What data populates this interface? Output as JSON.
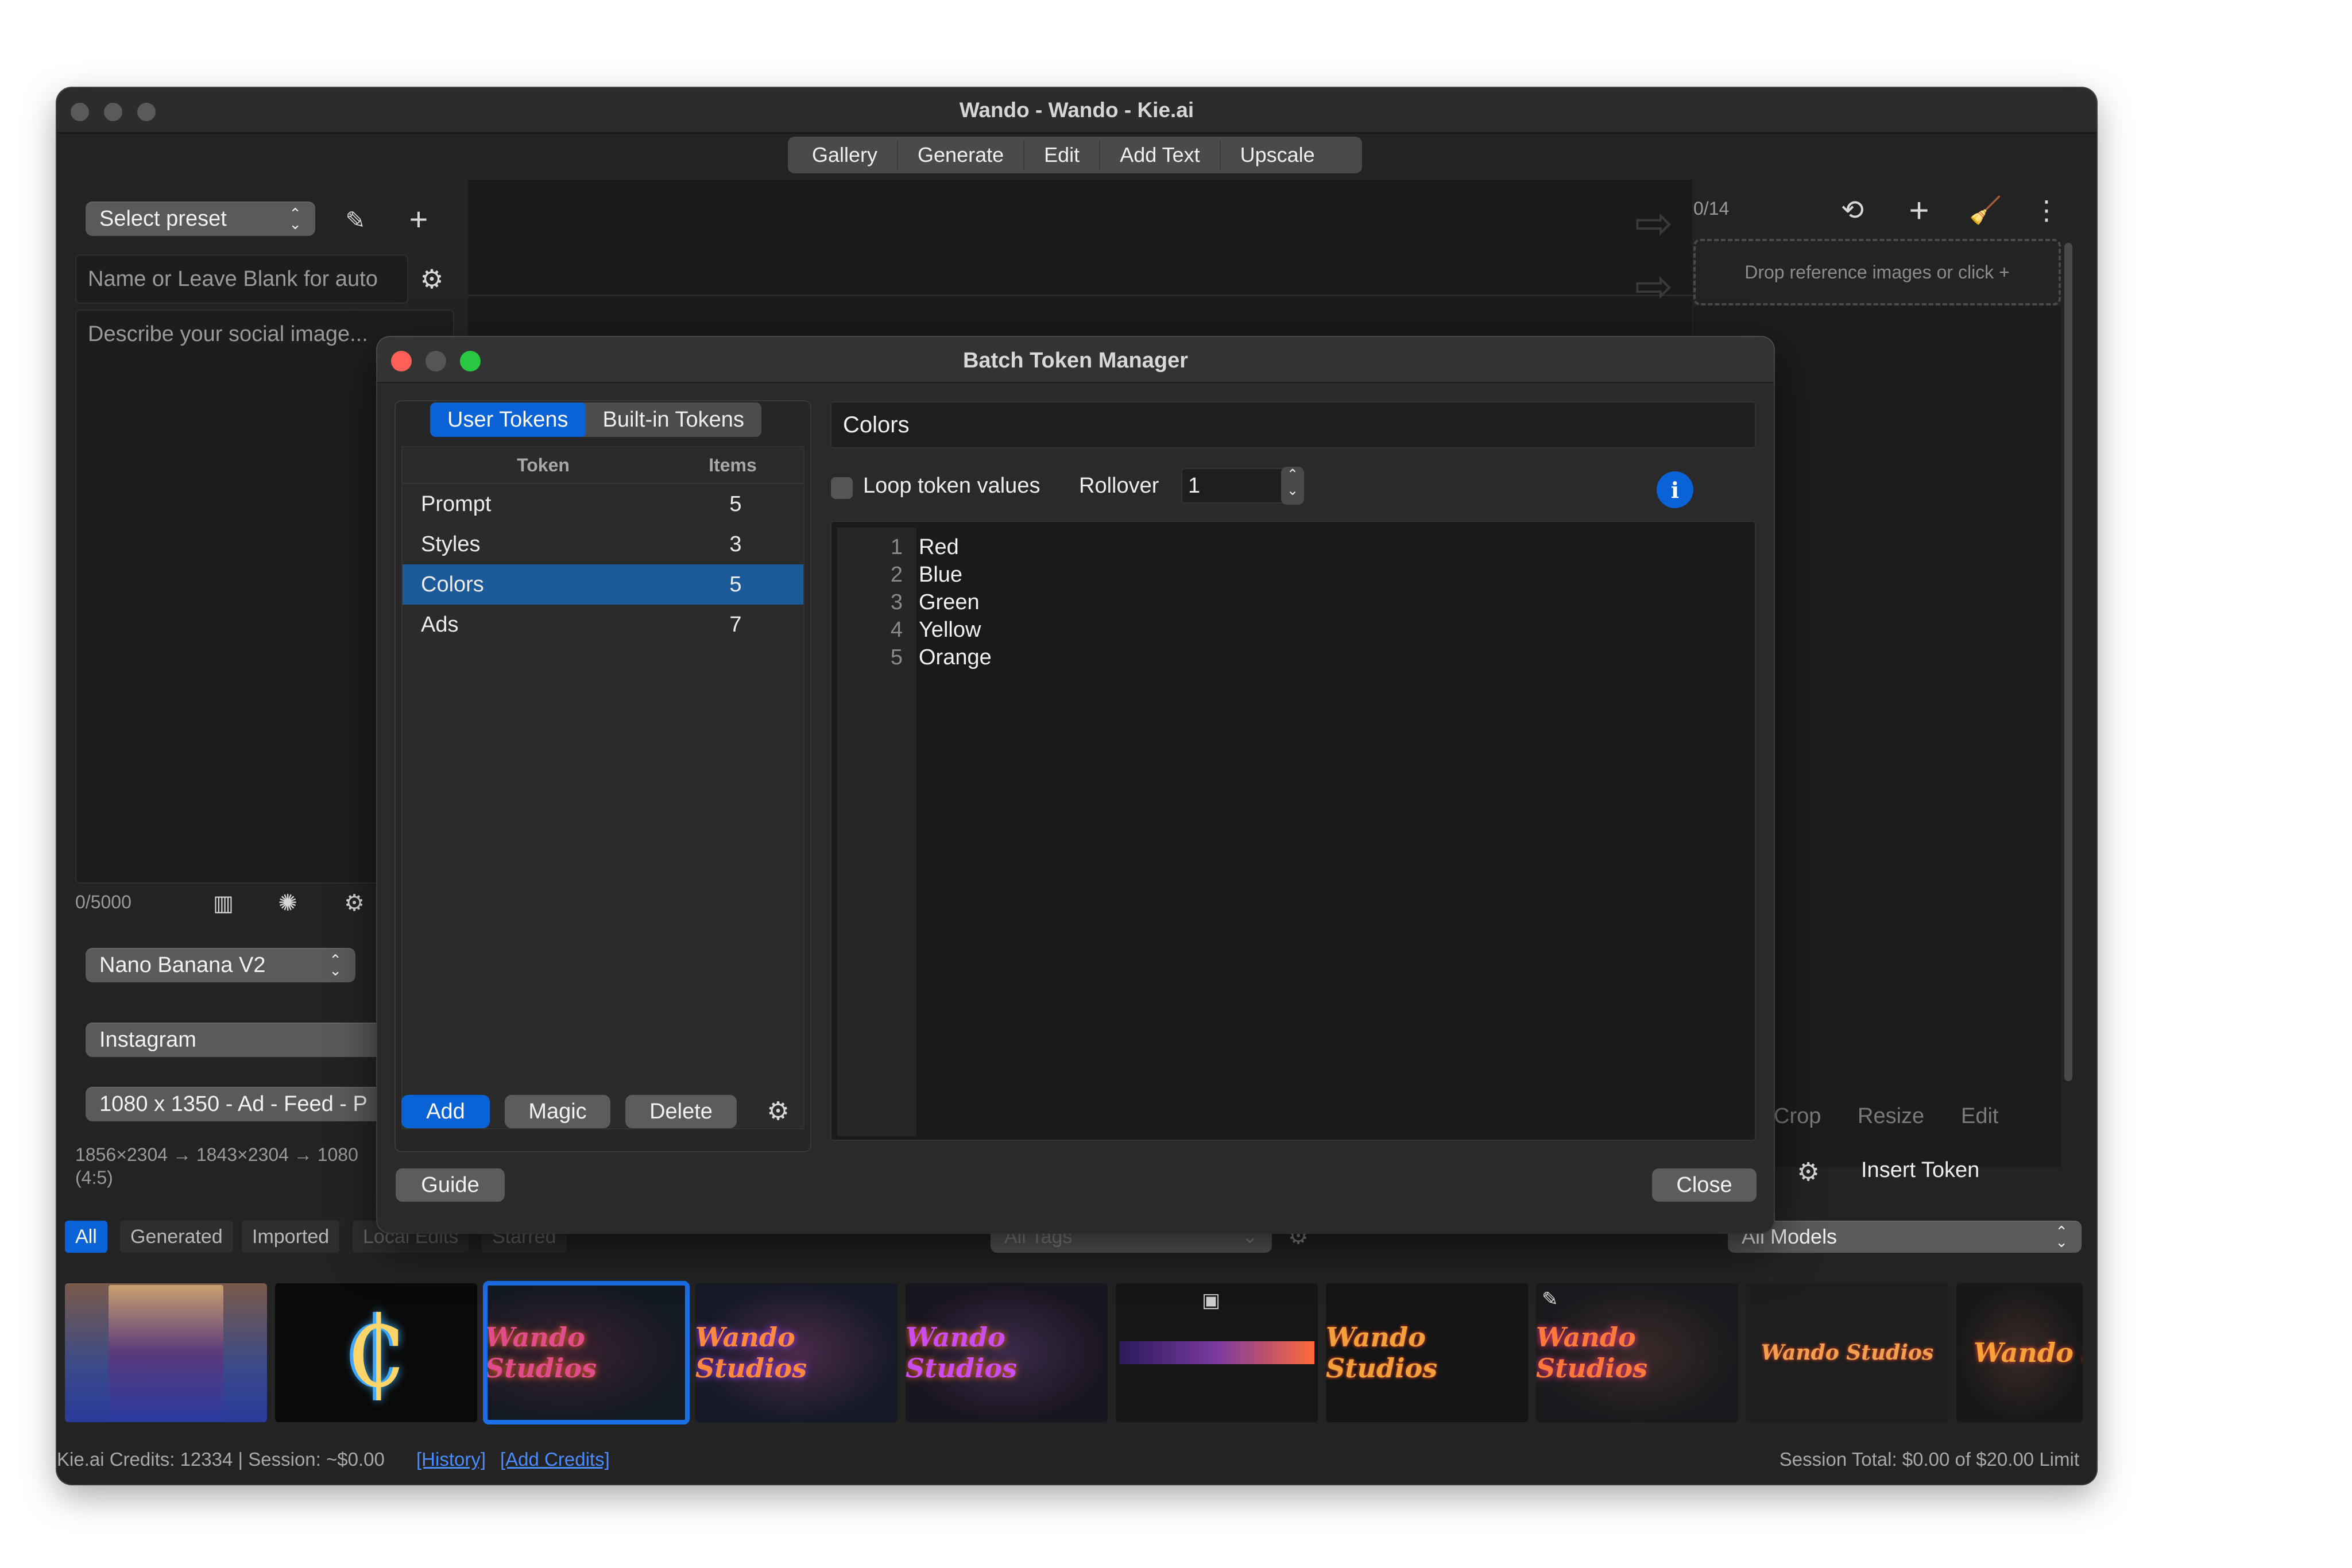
{
  "window": {
    "title": "Wando - Wando - Kie.ai",
    "menu": [
      "Gallery",
      "Generate",
      "Edit",
      "Add Text",
      "Upscale"
    ]
  },
  "left_panel": {
    "preset_select": "Select preset",
    "name_placeholder": "Name or Leave Blank for auto",
    "prompt_placeholder": "Describe your social image...",
    "char_count": "0/5000",
    "model_select": "Nano Banana V2",
    "platform_select": "Instagram",
    "size_select": "1080 x 1350 - Ad - Feed - P",
    "dimensions_line1": "1856×2304 → 1843×2304 → 1080",
    "dimensions_line2": "(4:5)"
  },
  "right_panel": {
    "ref_count": "0/14",
    "drop_hint": "Drop reference images or click +",
    "tools": [
      "Crop",
      "Resize",
      "Edit"
    ],
    "insert_token": "Insert Token"
  },
  "gallery_filters": {
    "tabs": [
      "All",
      "Generated",
      "Imported",
      "Local Edits",
      "Starred"
    ],
    "tags_select": "All Tags",
    "models_select": "All Models"
  },
  "thumbnails": [
    {
      "kind": "poster",
      "label": ""
    },
    {
      "kind": "logo",
      "label": "₵"
    },
    {
      "kind": "text",
      "label": "Wando Studios",
      "color": "#e04d8a"
    },
    {
      "kind": "text",
      "label": "Wando Studios",
      "color": "#ff8a3d"
    },
    {
      "kind": "text",
      "label": "Wando Studios",
      "color": "#c94df0"
    },
    {
      "kind": "gradient",
      "label": ""
    },
    {
      "kind": "text",
      "label": "Wando Studios",
      "color": "#f2a03c"
    },
    {
      "kind": "text",
      "label": "Wando Studios",
      "color": "#ff7a3a"
    },
    {
      "kind": "text",
      "label": "Wando Studios",
      "color": "#f0a050"
    },
    {
      "kind": "text",
      "label": "Wando St",
      "color": "#f7a13a"
    }
  ],
  "footer": {
    "credits": "Kie.ai Credits: 12334 | Session: ~$0.00",
    "history_link": "[History]",
    "add_credits_link": "[Add Credits]",
    "session_total": "Session Total: $0.00 of $20.00 Limit"
  },
  "dialog": {
    "title": "Batch Token Manager",
    "tabs": [
      "User Tokens",
      "Built-in Tokens"
    ],
    "active_tab": "User Tokens",
    "table_headers": {
      "token": "Token",
      "items": "Items"
    },
    "tokens": [
      {
        "name": "Prompt",
        "count": "5"
      },
      {
        "name": "Styles",
        "count": "3"
      },
      {
        "name": "Colors",
        "count": "5"
      },
      {
        "name": "Ads",
        "count": "7"
      }
    ],
    "selected_token": "Colors",
    "token_name_value": "Colors",
    "loop_label": "Loop token values",
    "loop_checked": false,
    "rollover_label": "Rollover",
    "rollover_value": "1",
    "info_label": "i",
    "values": [
      "Red",
      "Blue",
      "Green",
      "Yellow",
      "Orange"
    ],
    "buttons": {
      "add": "Add",
      "magic": "Magic",
      "delete": "Delete",
      "guide": "Guide",
      "close": "Close"
    }
  },
  "colors": {
    "accent": "#0a63d6",
    "selection": "#1c5a9a",
    "link": "#4a8cff"
  }
}
